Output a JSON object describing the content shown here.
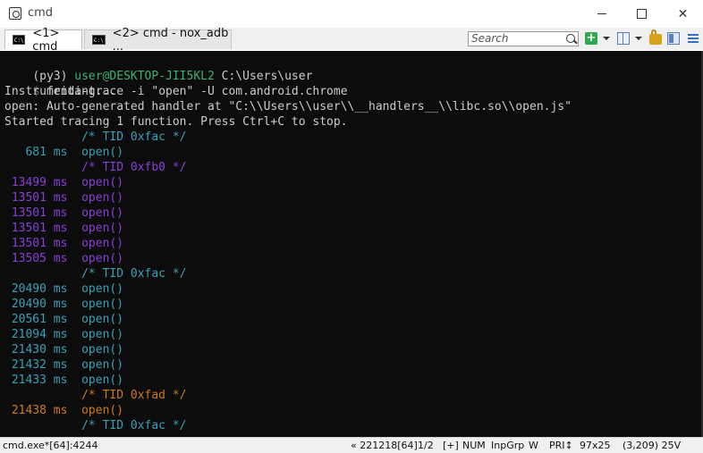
{
  "window": {
    "title": "cmd"
  },
  "tabs": [
    {
      "label": "<1> cmd",
      "icon": "cmd-icon"
    },
    {
      "label": "<2> cmd - nox_adb ...",
      "icon": "cmd-icon"
    }
  ],
  "toolbar": {
    "search_placeholder": "Search",
    "plus_symbol": "+"
  },
  "terminal": {
    "prompt": {
      "env": "(py3) ",
      "user": "user@DESKTOP-JII5KL2",
      "path": " C:\\Users\\user"
    },
    "command": {
      "symbol": "$ ",
      "text": "frida-trace -i \"open\" -U com.android.chrome"
    },
    "lines": [
      {
        "text": "Instrumenting...",
        "color": "#cccccc"
      },
      {
        "text": "open: Auto-generated handler at \"C:\\\\Users\\\\user\\\\__handlers__\\\\libc.so\\\\open.js\"",
        "color": "#cccccc"
      },
      {
        "text": "Started tracing 1 function. Press Ctrl+C to stop.",
        "color": "#cccccc"
      },
      {
        "text": "           /* TID 0xfac */",
        "color": "#3aa0b8"
      },
      {
        "text": "   681 ms  open()",
        "color": "#3aa0b8"
      },
      {
        "text": "           /* TID 0xfb0 */",
        "color": "#8a3fd8"
      },
      {
        "text": " 13499 ms  open()",
        "color": "#8a3fd8"
      },
      {
        "text": " 13501 ms  open()",
        "color": "#8a3fd8"
      },
      {
        "text": " 13501 ms  open()",
        "color": "#8a3fd8"
      },
      {
        "text": " 13501 ms  open()",
        "color": "#8a3fd8"
      },
      {
        "text": " 13501 ms  open()",
        "color": "#8a3fd8"
      },
      {
        "text": " 13505 ms  open()",
        "color": "#8a3fd8"
      },
      {
        "text": "           /* TID 0xfac */",
        "color": "#3aa0b8"
      },
      {
        "text": " 20490 ms  open()",
        "color": "#3aa0b8"
      },
      {
        "text": " 20490 ms  open()",
        "color": "#3aa0b8"
      },
      {
        "text": " 20561 ms  open()",
        "color": "#3aa0b8"
      },
      {
        "text": " 21094 ms  open()",
        "color": "#3aa0b8"
      },
      {
        "text": " 21430 ms  open()",
        "color": "#3aa0b8"
      },
      {
        "text": " 21432 ms  open()",
        "color": "#3aa0b8"
      },
      {
        "text": " 21433 ms  open()",
        "color": "#3aa0b8"
      },
      {
        "text": "           /* TID 0xfad */",
        "color": "#d07a1c"
      },
      {
        "text": " 21438 ms  open()",
        "color": "#d07a1c"
      },
      {
        "text": "           /* TID 0xfac */",
        "color": "#3aa0b8"
      }
    ]
  },
  "status": {
    "process": "cmd.exe*[64]:4244",
    "build": "« 221218[64]",
    "page": "1/2",
    "plus": "[+]",
    "num": "NUM",
    "inpgrp": "InpGrp",
    "w": "W",
    "pri": "PRI↕",
    "size": "97x25",
    "pos": "(3,209) 25V"
  },
  "colors": {
    "prompt_green": "#3cb371",
    "gray": "#cccccc",
    "dim": "#6a6a6a"
  }
}
